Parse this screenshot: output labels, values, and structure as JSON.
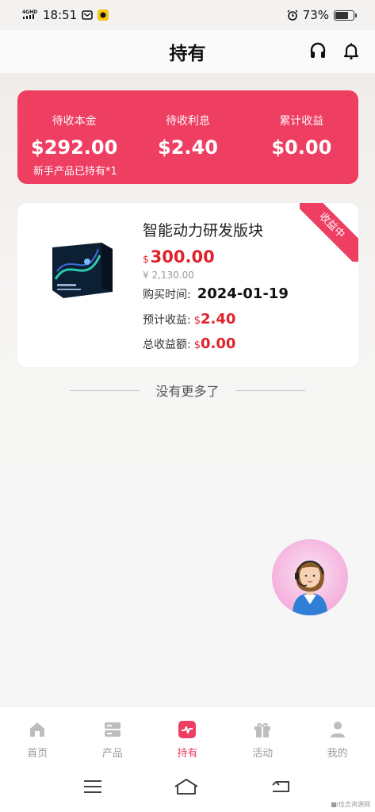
{
  "status_bar": {
    "network": "4G HD",
    "time": "18:51",
    "battery_percent": "73%",
    "battery_level": 0.73
  },
  "header": {
    "title": "持有",
    "icons": [
      "headset-icon",
      "bell-icon"
    ]
  },
  "summary": {
    "pending_principal_label": "待收本金",
    "pending_principal_value": "$292.00",
    "pending_interest_label": "待收利息",
    "pending_interest_value": "$2.40",
    "total_earnings_label": "累计收益",
    "total_earnings_value": "$0.00",
    "note": "新手产品已持有*1"
  },
  "product": {
    "name": "智能动力研发版块",
    "status_badge": "收益中",
    "currency_symbol": "$",
    "price": "300.00",
    "original_price": "¥ 2,130.00",
    "purchase_time_label": "购买时间:",
    "purchase_time_value": "2024-01-19",
    "expected_income_label": "预计收益:",
    "expected_income_value": "2.40",
    "total_income_label": "总收益额:",
    "total_income_value": "0.00"
  },
  "list_footer": {
    "no_more": "没有更多了"
  },
  "colors": {
    "accent": "#ee3e62",
    "price_red": "#e0222b"
  },
  "bottom_nav": {
    "items": [
      {
        "label": "首页",
        "icon": "home-icon",
        "active": false
      },
      {
        "label": "产品",
        "icon": "products-icon",
        "active": false
      },
      {
        "label": "持有",
        "icon": "holdings-icon",
        "active": true
      },
      {
        "label": "活动",
        "icon": "gift-icon",
        "active": false
      },
      {
        "label": "我的",
        "icon": "user-icon",
        "active": false
      }
    ]
  },
  "watermark": "■i佳志资源网"
}
